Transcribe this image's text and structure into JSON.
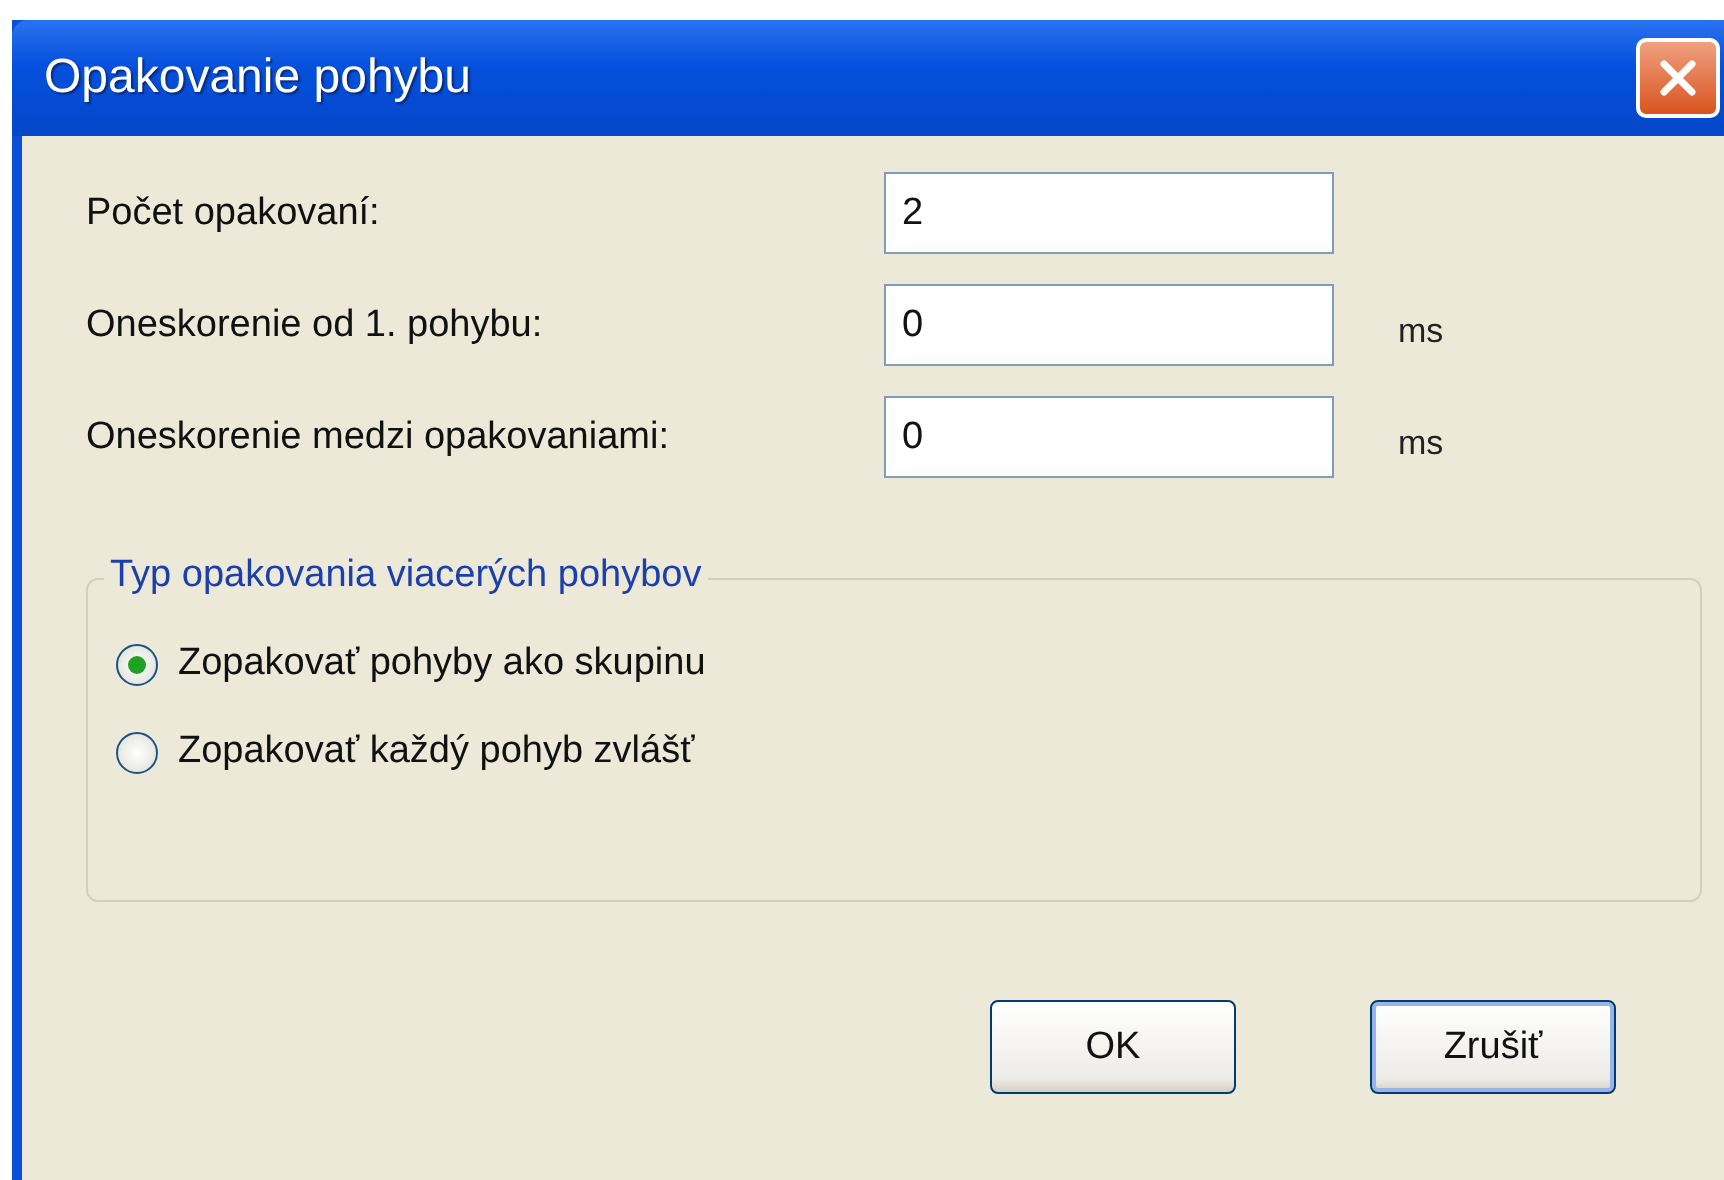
{
  "window": {
    "title": "Opakovanie pohybu"
  },
  "fields": [
    {
      "label": "Počet opakovaní:",
      "value": "2"
    },
    {
      "label": "Oneskorenie od 1. pohybu:",
      "value": "0",
      "unit": "ms"
    },
    {
      "label": "Oneskorenie medzi opakovaniami:",
      "value": "0",
      "unit": "ms"
    }
  ],
  "group": {
    "title": "Typ opakovania viacerých pohybov",
    "options": [
      {
        "label": "Zopakovať pohyby ako skupinu",
        "selected": true
      },
      {
        "label": "Zopakovať každý pohyb zvlášť",
        "selected": false
      }
    ]
  },
  "buttons": [
    {
      "label": "OK",
      "default": false
    },
    {
      "label": "Zrušiť",
      "default": true
    }
  ]
}
